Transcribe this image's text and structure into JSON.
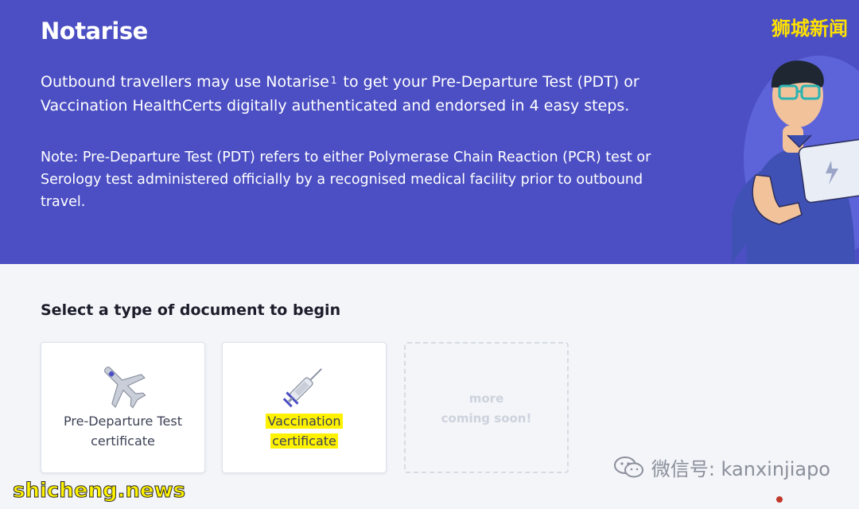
{
  "brand": "Notarise",
  "intro": {
    "before": "Outbound travellers may use Notarise",
    "sup": "1",
    "after": " to get your Pre-Departure Test (PDT) or Vaccination HealthCerts digitally authenticated and endorsed in 4 easy steps."
  },
  "note": "Note: Pre-Departure Test (PDT) refers to either Polymerase Chain Reaction (PCR) test or Serology test administered officially by a recognised medical facility prior to outbound travel.",
  "section_title": "Select a type of document to begin",
  "cards": {
    "pdt": {
      "line1": "Pre-Departure Test",
      "line2": "certificate",
      "icon": "airplane-icon"
    },
    "vax": {
      "line1": "Vaccination",
      "line2": "certificate",
      "icon": "syringe-icon"
    },
    "soon": {
      "line1": "more",
      "line2": "coming soon!"
    }
  },
  "watermarks": {
    "top_right": "狮城新闻",
    "bottom_left": "shicheng.news",
    "wechat": "微信号: kanxinjiapo"
  },
  "colors": {
    "hero_bg": "#4c4fc3",
    "page_bg": "#f3f5f9",
    "highlight": "#fff200"
  }
}
